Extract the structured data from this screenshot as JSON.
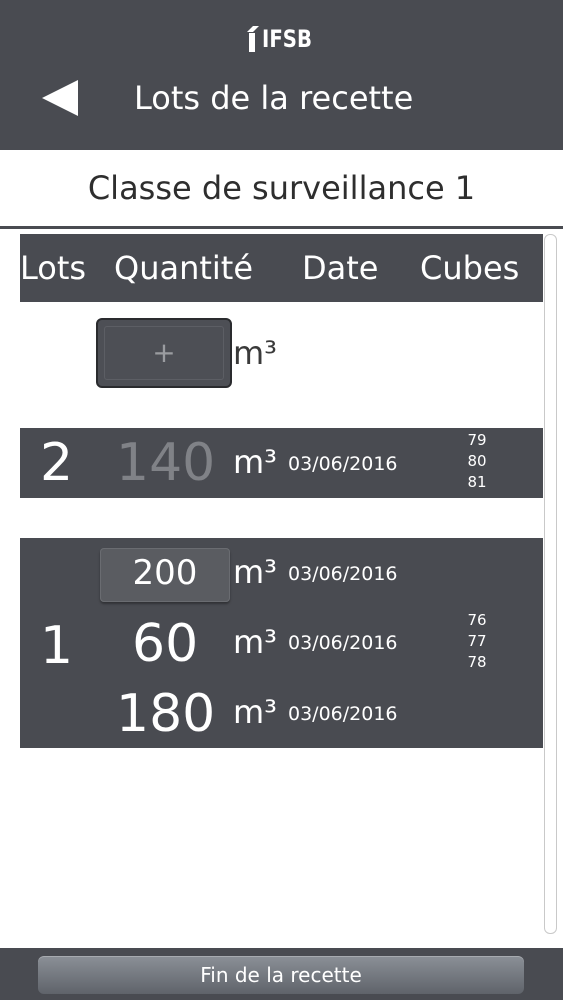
{
  "header": {
    "logo_text": "IFSB",
    "title": "Lots de la recette"
  },
  "class_title": "Classe de surveillance 1",
  "columns": [
    "Lots",
    "Quantité",
    "Date",
    "Cubes"
  ],
  "new_lot": {
    "add_label": "+",
    "unit": "m³"
  },
  "lots": [
    {
      "number": "2",
      "entries": [
        {
          "quantity": "140",
          "unit": "m³",
          "date": "03/06/2016"
        }
      ],
      "cubes": [
        "79",
        "80",
        "81"
      ]
    },
    {
      "number": "1",
      "entries": [
        {
          "quantity": "200",
          "unit": "m³",
          "date": "03/06/2016"
        },
        {
          "quantity": "60",
          "unit": "m³",
          "date": "03/06/2016"
        },
        {
          "quantity": "180",
          "unit": "m³",
          "date": "03/06/2016"
        }
      ],
      "cubes": [
        "76",
        "77",
        "78"
      ]
    }
  ],
  "footer": {
    "finish_label": "Fin de la recette"
  },
  "colors": {
    "header_bg": "#494b51",
    "row_bg": "#494b51",
    "dim_text": "#808287",
    "text": "#ffffff"
  }
}
